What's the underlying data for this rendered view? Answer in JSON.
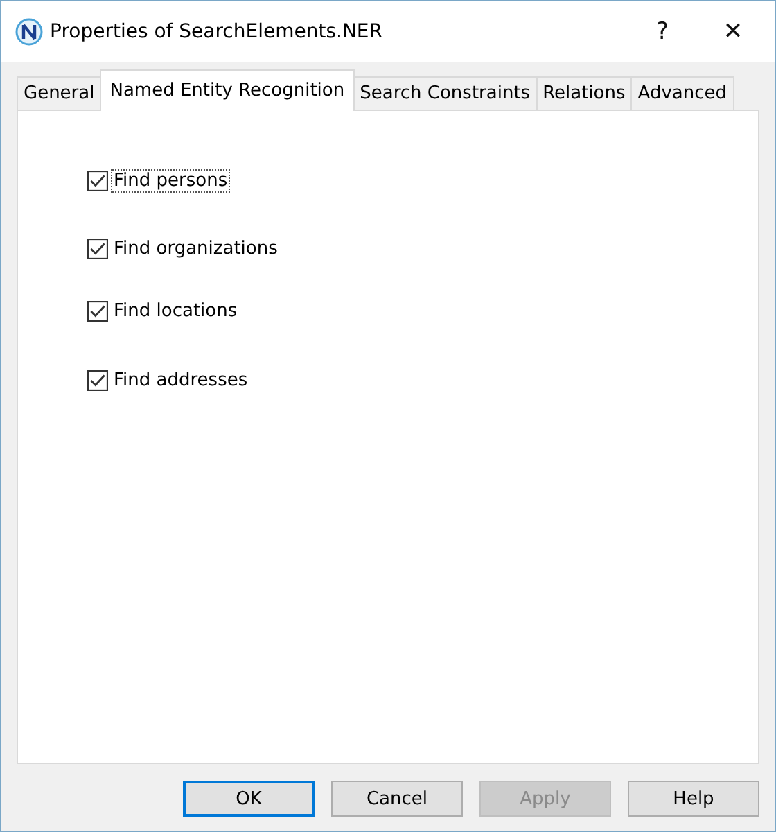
{
  "window": {
    "title": "Properties of SearchElements.NER",
    "help": "?",
    "close": "✕"
  },
  "tabs": [
    {
      "label": "General",
      "selected": false
    },
    {
      "label": "Named Entity Recognition",
      "selected": true
    },
    {
      "label": "Search Constraints",
      "selected": false
    },
    {
      "label": "Relations",
      "selected": false
    },
    {
      "label": "Advanced",
      "selected": false
    }
  ],
  "options": [
    {
      "label": "Find persons",
      "checked": true,
      "focused": true
    },
    {
      "label": "Find organizations",
      "checked": true,
      "focused": false
    },
    {
      "label": "Find locations",
      "checked": true,
      "focused": false
    },
    {
      "label": "Find addresses",
      "checked": true,
      "focused": false
    }
  ],
  "buttons": [
    {
      "label": "OK",
      "default": true,
      "disabled": false
    },
    {
      "label": "Cancel",
      "default": false,
      "disabled": false
    },
    {
      "label": "Apply",
      "default": false,
      "disabled": true
    },
    {
      "label": "Help",
      "default": false,
      "disabled": false
    }
  ]
}
